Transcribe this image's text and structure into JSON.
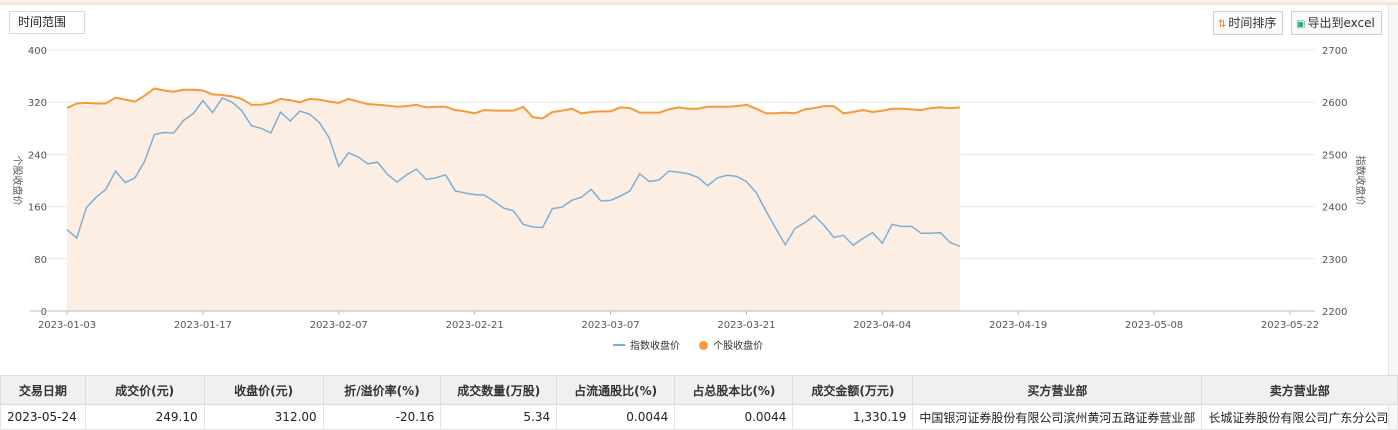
{
  "toolbar": {
    "range_label": "时间范围",
    "sort_label": "时间排序",
    "export_label": "导出到excel"
  },
  "colors": {
    "index_line": "#7bb0d6",
    "stock_line": "#f59a3a",
    "area_fill": "#fdeee3",
    "grid": "#e9e9e9"
  },
  "chart_data": {
    "type": "line",
    "left_axis_label": "个股收盘价",
    "right_axis_label": "指数收盘价",
    "left_ylim": [
      0,
      400
    ],
    "right_ylim": [
      2200,
      2700
    ],
    "left_ticks": [
      "0",
      "80",
      "160",
      "240",
      "320",
      "400"
    ],
    "right_ticks": [
      "2200",
      "2300",
      "2400",
      "2500",
      "2600",
      "2700"
    ],
    "x_tick_labels": [
      "2023-01-03",
      "2023-01-17",
      "2023-02-07",
      "2023-02-21",
      "2023-03-07",
      "2023-03-21",
      "2023-04-04",
      "2023-04-19",
      "2023-05-08",
      "2023-05-22"
    ],
    "x_tick_positions": [
      0,
      14,
      28,
      42,
      56,
      70,
      84,
      98,
      112,
      126
    ],
    "grid": true,
    "legend_position": "bottom",
    "series": [
      {
        "name": "指数收盘价",
        "axis": "right",
        "values": [
          2356,
          2340,
          2398,
          2418,
          2433,
          2468,
          2446,
          2455,
          2487,
          2538,
          2542,
          2541,
          2565,
          2578,
          2603,
          2580,
          2608,
          2600,
          2584,
          2555,
          2550,
          2541,
          2581,
          2564,
          2583,
          2577,
          2561,
          2532,
          2477,
          2503,
          2495,
          2482,
          2485,
          2462,
          2447,
          2461,
          2472,
          2452,
          2455,
          2461,
          2430,
          2426,
          2423,
          2422,
          2410,
          2397,
          2392,
          2366,
          2361,
          2360,
          2396,
          2399,
          2412,
          2418,
          2433,
          2411,
          2412,
          2420,
          2430,
          2463,
          2448,
          2451,
          2468,
          2466,
          2463,
          2456,
          2440,
          2455,
          2460,
          2458,
          2448,
          2427,
          2392,
          2359,
          2327,
          2358,
          2369,
          2383,
          2364,
          2341,
          2345,
          2326,
          2339,
          2350,
          2330,
          2366,
          2362,
          2362,
          2349,
          2349,
          2350,
          2331,
          2324
        ],
        "_note_x": "index positions spread between first and last tick"
      },
      {
        "name": "个股收盘价",
        "axis": "left",
        "values": [
          311,
          318,
          319,
          318,
          318,
          327,
          324,
          321,
          330,
          341,
          338,
          336,
          339,
          339,
          338,
          332,
          331,
          329,
          325,
          316,
          316,
          319,
          325,
          323,
          320,
          325,
          324,
          321,
          319,
          325,
          321,
          317,
          316,
          315,
          313,
          314,
          316,
          312,
          313,
          313,
          308,
          306,
          303,
          308,
          307,
          307,
          307,
          313,
          297,
          295,
          305,
          307,
          310,
          303,
          305,
          306,
          306,
          312,
          311,
          304,
          304,
          304,
          309,
          312,
          310,
          310,
          313,
          313,
          313,
          314,
          316,
          310,
          303,
          303,
          304,
          303,
          309,
          311,
          314,
          314,
          303,
          305,
          308,
          305,
          307,
          310,
          310,
          309,
          308,
          311,
          312,
          311,
          312
        ]
      }
    ]
  },
  "table": {
    "headers": [
      "交易日期",
      "成交价(元)",
      "收盘价(元)",
      "折/溢价率(%)",
      "成交数量(万股)",
      "占流通股比(%)",
      "占总股本比(%)",
      "成交金额(万元)",
      "买方营业部",
      "卖方营业部"
    ],
    "rows": [
      [
        "2023-05-24",
        "249.10",
        "312.00",
        "-20.16",
        "5.34",
        "0.0044",
        "0.0044",
        "1,330.19",
        "中国银河证券股份有限公司滨州黄河五路证券营业部",
        "长城证券股份有限公司广东分公司"
      ]
    ]
  }
}
